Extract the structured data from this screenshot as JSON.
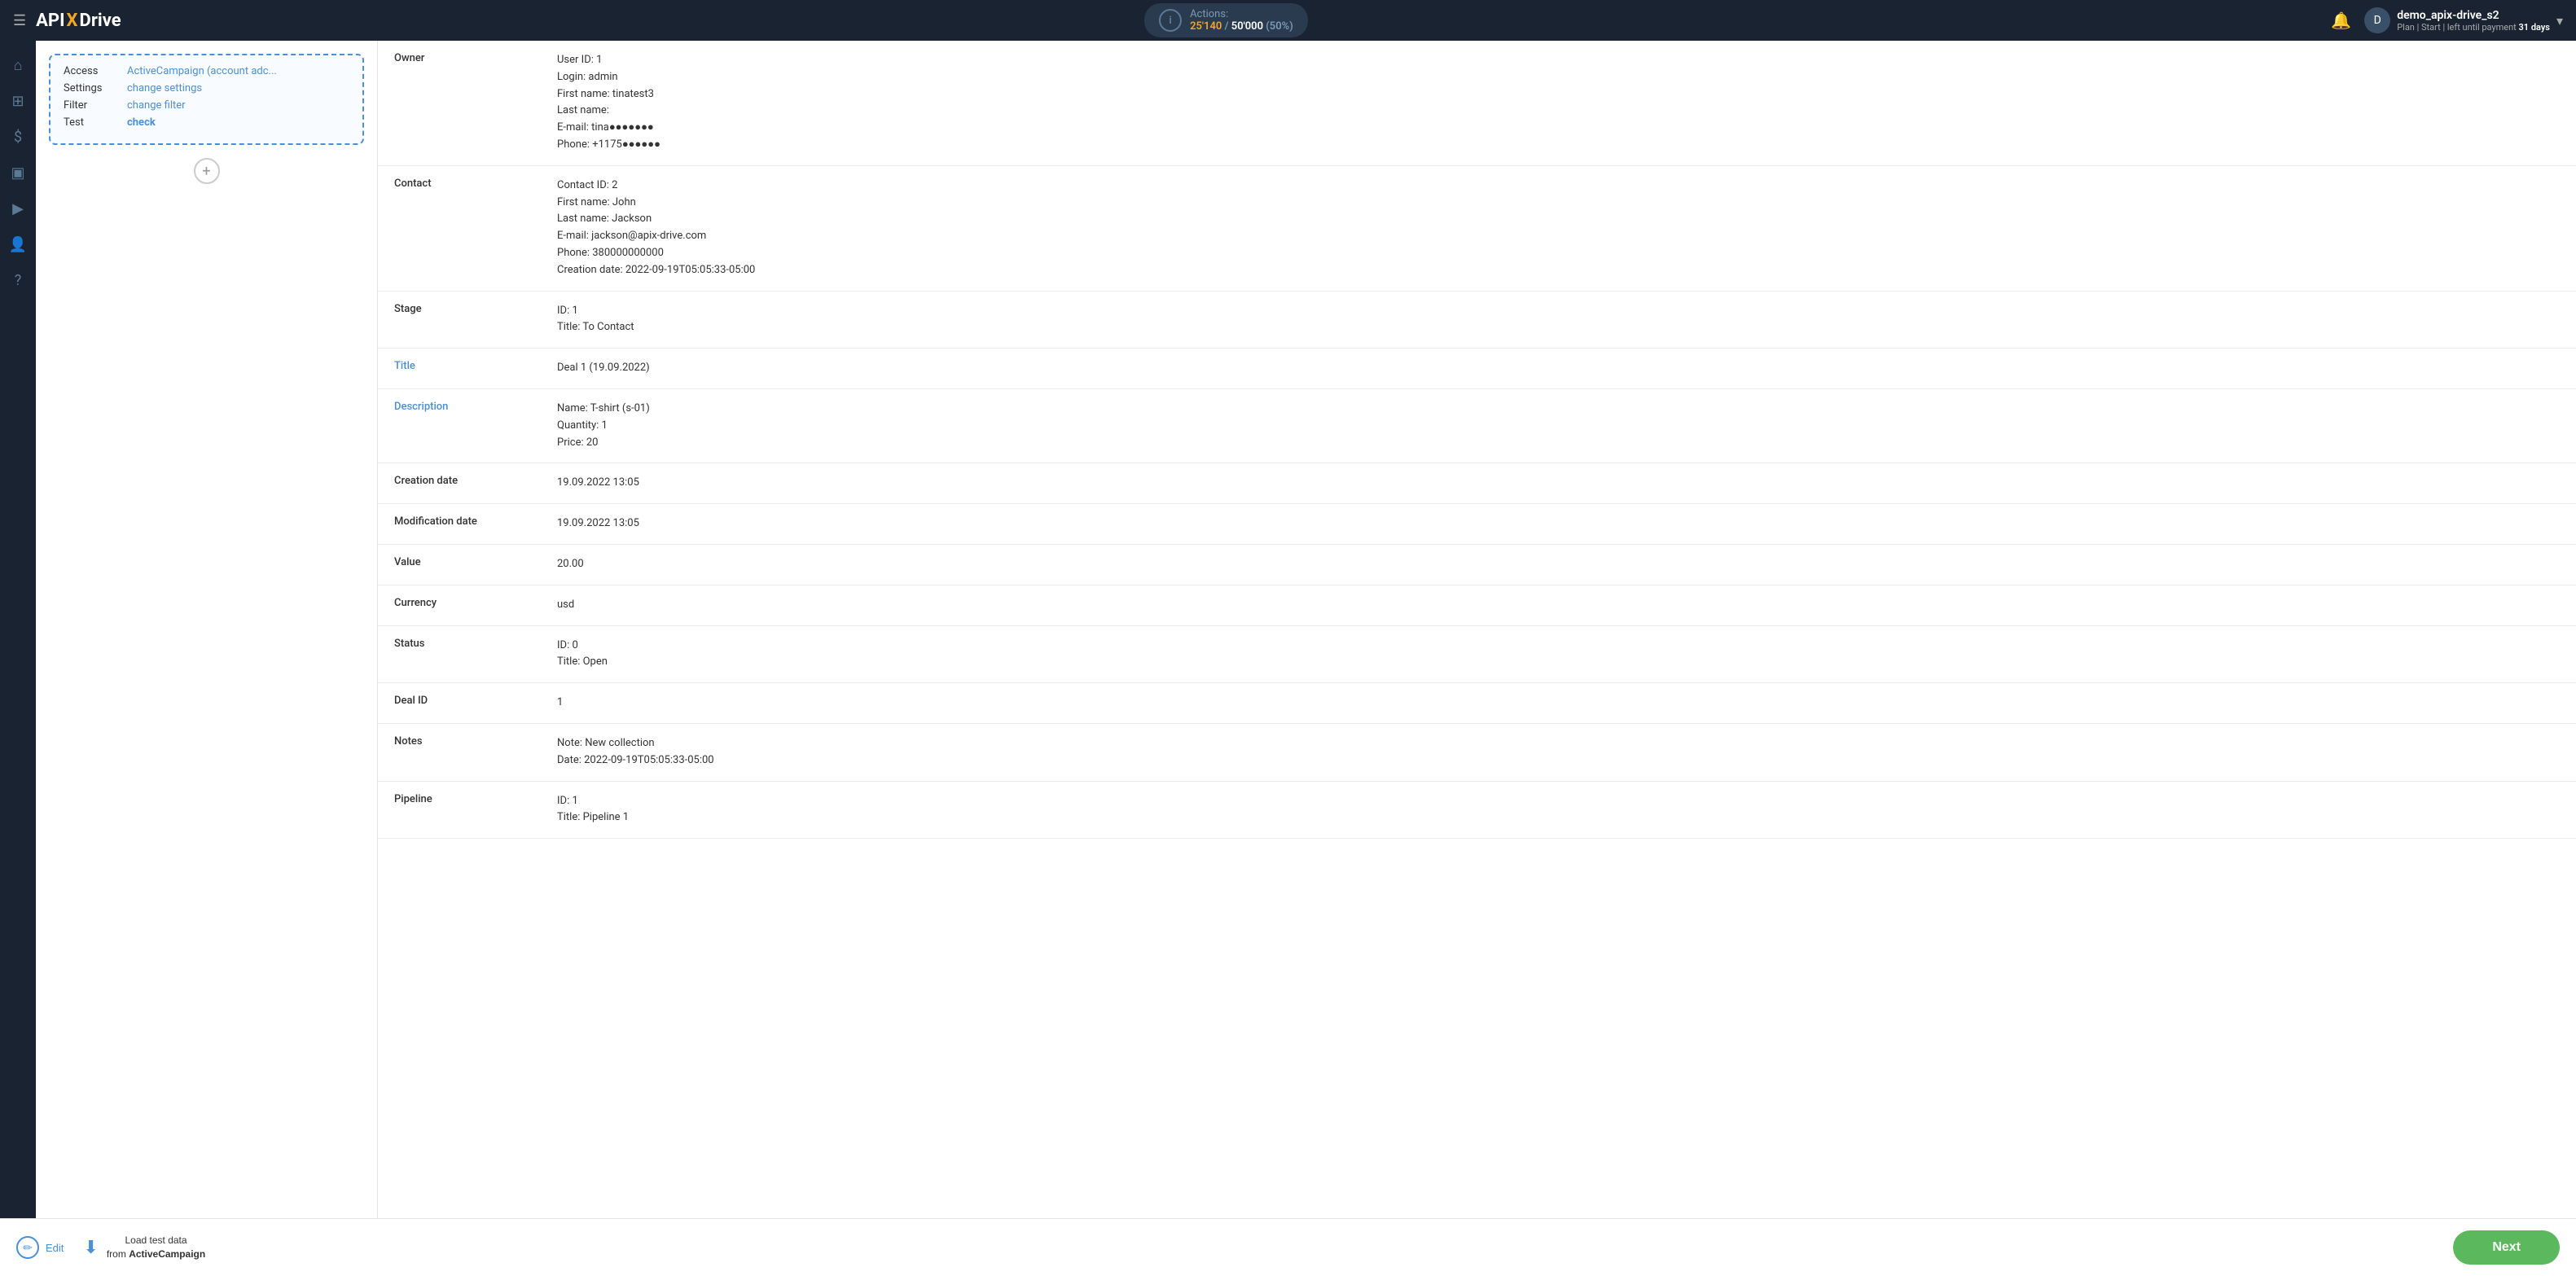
{
  "header": {
    "hamburger_label": "☰",
    "logo": {
      "api": "API",
      "x": "X",
      "drive": "Drive"
    },
    "actions": {
      "label": "Actions:",
      "used": "25'140",
      "total": "50'000",
      "percent": "(50%)"
    },
    "bell_icon": "🔔",
    "user": {
      "name": "demo_apix-drive_s2",
      "plan_text": "Plan | Start | left until payment",
      "days": "31 days",
      "avatar_letter": "D"
    }
  },
  "sidebar": {
    "icons": [
      {
        "name": "home-icon",
        "symbol": "⌂",
        "active": false
      },
      {
        "name": "grid-icon",
        "symbol": "⊞",
        "active": false
      },
      {
        "name": "dollar-icon",
        "symbol": "$",
        "active": false
      },
      {
        "name": "briefcase-icon",
        "symbol": "⊡",
        "active": false
      },
      {
        "name": "play-icon",
        "symbol": "▶",
        "active": false
      },
      {
        "name": "user-icon",
        "symbol": "👤",
        "active": false
      },
      {
        "name": "question-icon",
        "symbol": "?",
        "active": false
      }
    ]
  },
  "source_card": {
    "access_label": "Access",
    "access_value": "ActiveCampaign (account adc...",
    "settings_label": "Settings",
    "settings_value": "change settings",
    "filter_label": "Filter",
    "filter_value": "change filter",
    "test_label": "Test",
    "test_value": "check"
  },
  "add_button": "+",
  "detail_rows": [
    {
      "label": "Owner",
      "value": "User ID: 1\nLogin: admin\nFirst name: tinatest3\nLast name:\nE-mail: tina●●●●●●●\nPhone: +1175●●●●●●",
      "blue_label": false
    },
    {
      "label": "Contact",
      "value": "Contact ID: 2\nFirst name: John\nLast name: Jackson\nE-mail: jackson@apix-drive.com\nPhone: 380000000000\nCreation date: 2022-09-19T05:05:33-05:00",
      "blue_label": false
    },
    {
      "label": "Stage",
      "value": "ID: 1\nTitle: To Contact",
      "blue_label": false
    },
    {
      "label": "Title",
      "value": "Deal 1 (19.09.2022)",
      "blue_label": true
    },
    {
      "label": "Description",
      "value": "Name: T-shirt (s-01)\nQuantity: 1\nPrice: 20",
      "blue_label": true
    },
    {
      "label": "Creation date",
      "value": "19.09.2022 13:05",
      "blue_label": false
    },
    {
      "label": "Modification date",
      "value": "19.09.2022 13:05",
      "blue_label": false
    },
    {
      "label": "Value",
      "value": "20.00",
      "blue_label": false
    },
    {
      "label": "Currency",
      "value": "usd",
      "blue_label": false
    },
    {
      "label": "Status",
      "value": "ID: 0\nTitle: Open",
      "blue_label": false
    },
    {
      "label": "Deal ID",
      "value": "1",
      "blue_label": false
    },
    {
      "label": "Notes",
      "value": "Note: New collection\nDate: 2022-09-19T05:05:33-05:00",
      "blue_label": false
    },
    {
      "label": "Pipeline",
      "value": "ID: 1\nTitle: Pipeline 1",
      "blue_label": false
    }
  ],
  "footer": {
    "edit_label": "Edit",
    "load_label_line1": "Load test data",
    "load_label_line2": "from ActiveCampaign",
    "next_label": "Next"
  }
}
